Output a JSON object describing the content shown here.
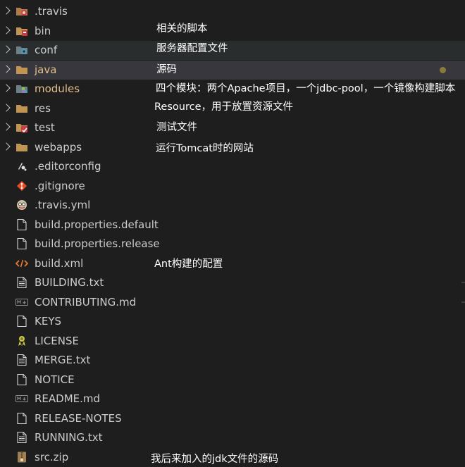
{
  "explorer": {
    "items": [
      {
        "name": ".travis",
        "type": "folder",
        "icon": "travis-folder-icon",
        "note": ""
      },
      {
        "name": "bin",
        "type": "folder",
        "icon": "bin-folder-icon",
        "note": "相关的脚本"
      },
      {
        "name": "conf",
        "type": "folder",
        "icon": "config-folder-icon",
        "note": "服务器配置文件"
      },
      {
        "name": "java",
        "type": "folder",
        "icon": "folder-icon",
        "note": "源码",
        "modified": true
      },
      {
        "name": "modules",
        "type": "folder",
        "icon": "modules-folder-icon",
        "note": "四个模块：两个Apache项目，一个jdbc-pool，一个镜像构建脚本",
        "modified": true
      },
      {
        "name": "res",
        "type": "folder",
        "icon": "folder-icon",
        "note": "Resource，用于放置资源文件"
      },
      {
        "name": "test",
        "type": "folder",
        "icon": "test-folder-icon",
        "note": "测试文件"
      },
      {
        "name": "webapps",
        "type": "folder",
        "icon": "folder-icon",
        "note": "运行Tomcat时的网站"
      },
      {
        "name": ".editorconfig",
        "type": "file",
        "icon": "editorconfig-icon",
        "note": ""
      },
      {
        "name": ".gitignore",
        "type": "file",
        "icon": "git-icon",
        "note": ""
      },
      {
        "name": ".travis.yml",
        "type": "file",
        "icon": "travis-icon",
        "note": ""
      },
      {
        "name": "build.properties.default",
        "type": "file",
        "icon": "file-icon",
        "note": ""
      },
      {
        "name": "build.properties.release",
        "type": "file",
        "icon": "file-icon",
        "note": ""
      },
      {
        "name": "build.xml",
        "type": "file",
        "icon": "xml-icon",
        "note": "Ant构建的配置"
      },
      {
        "name": "BUILDING.txt",
        "type": "file",
        "icon": "text-file-icon",
        "note": ""
      },
      {
        "name": "CONTRIBUTING.md",
        "type": "file",
        "icon": "markdown-icon",
        "note": ""
      },
      {
        "name": "KEYS",
        "type": "file",
        "icon": "file-icon",
        "note": ""
      },
      {
        "name": "LICENSE",
        "type": "file",
        "icon": "license-icon",
        "note": ""
      },
      {
        "name": "MERGE.txt",
        "type": "file",
        "icon": "text-file-icon",
        "note": ""
      },
      {
        "name": "NOTICE",
        "type": "file",
        "icon": "file-icon",
        "note": ""
      },
      {
        "name": "README.md",
        "type": "file",
        "icon": "markdown-icon",
        "note": ""
      },
      {
        "name": "RELEASE-NOTES",
        "type": "file",
        "icon": "file-icon",
        "note": ""
      },
      {
        "name": "RUNNING.txt",
        "type": "file",
        "icon": "text-file-icon",
        "note": ""
      },
      {
        "name": "src.zip",
        "type": "file",
        "icon": "zip-icon",
        "note": "我后来加入的jdk文件的源码"
      }
    ],
    "colors": {
      "background": "#1e1e1e",
      "text": "#cccccc",
      "modified_text": "#e2c08d",
      "selected_row": "#37373d",
      "note_text": "#ffffff",
      "folder": "#c09553"
    }
  }
}
